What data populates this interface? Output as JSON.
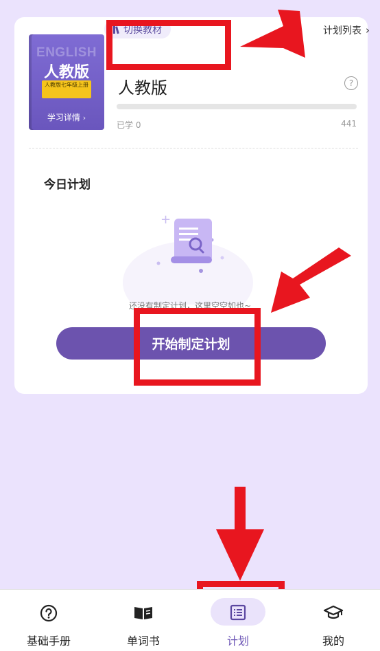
{
  "book": {
    "cover_en": "ENGLISH",
    "cover_name": "人教版",
    "cover_grade": "人教版七年级上册",
    "detail_label": "学习详情"
  },
  "header": {
    "switch_label": "切换教材",
    "plan_list_label": "计划列表"
  },
  "edition": {
    "title": "人教版",
    "learned_label": "已学 0",
    "total": "441",
    "progress_fraction": 0
  },
  "today": {
    "heading": "今日计划",
    "empty_text": "还没有制定计划，这里空空如也~",
    "start_button": "开始制定计划"
  },
  "tabs": [
    {
      "label": "基础手册",
      "icon": "question-circle-icon"
    },
    {
      "label": "单词书",
      "icon": "open-book-icon"
    },
    {
      "label": "计划",
      "icon": "list-icon"
    },
    {
      "label": "我的",
      "icon": "graduation-cap-icon"
    }
  ],
  "colors": {
    "accent": "#6c53ae",
    "background": "#ebe3fd",
    "annotation": "#e8161f"
  }
}
